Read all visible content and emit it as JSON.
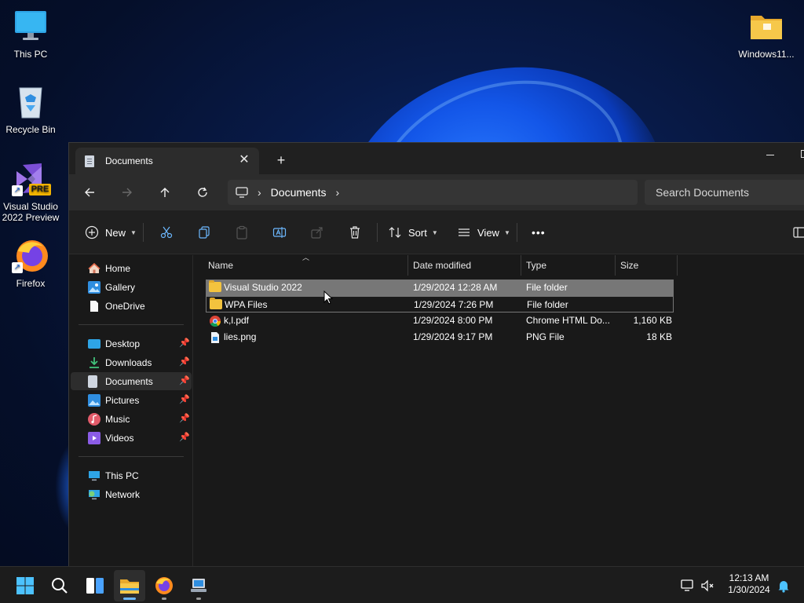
{
  "desktop": {
    "icons": [
      {
        "label": "This PC",
        "icon": "monitor-icon"
      },
      {
        "label": "Recycle Bin",
        "icon": "recycle-bin-icon"
      },
      {
        "label": "Visual Studio 2022 Preview",
        "badge": "PRE",
        "icon": "visual-studio-icon"
      },
      {
        "label": "Firefox",
        "icon": "firefox-icon"
      },
      {
        "label": "Windows11...",
        "icon": "folder-icon"
      }
    ]
  },
  "window": {
    "tab_title": "Documents",
    "tab_close": "✕",
    "new_tab": "+",
    "breadcrumb": {
      "location": "Documents"
    },
    "search": {
      "placeholder": "Search Documents"
    },
    "commands": {
      "new": "New",
      "sort": "Sort",
      "view": "View",
      "more": "•••"
    },
    "sidebar": {
      "home": "Home",
      "gallery": "Gallery",
      "onedrive": "OneDrive",
      "desktop": "Desktop",
      "downloads": "Downloads",
      "documents": "Documents",
      "pictures": "Pictures",
      "music": "Music",
      "videos": "Videos",
      "thispc": "This PC",
      "network": "Network"
    },
    "columns": {
      "name": "Name",
      "date": "Date modified",
      "type": "Type",
      "size": "Size"
    },
    "files": [
      {
        "name": "Visual Studio 2022",
        "date": "1/29/2024 12:28 AM",
        "type": "File folder",
        "size": "",
        "icon": "folder-icon"
      },
      {
        "name": "WPA Files",
        "date": "1/29/2024 7:26 PM",
        "type": "File folder",
        "size": "",
        "icon": "folder-icon"
      },
      {
        "name": "k,l.pdf",
        "date": "1/29/2024 8:00 PM",
        "type": "Chrome HTML Do...",
        "size": "1,160 KB",
        "icon": "chrome-icon"
      },
      {
        "name": "lies.png",
        "date": "1/29/2024 9:17 PM",
        "type": "PNG File",
        "size": "18 KB",
        "icon": "image-file-icon"
      }
    ]
  },
  "taskbar": {
    "time": "12:13 AM",
    "date": "1/30/2024"
  },
  "colors": {
    "selection": "#777777",
    "accent": "#6cb8ff",
    "window_bg": "#191919",
    "folder": "#f3c33e"
  }
}
